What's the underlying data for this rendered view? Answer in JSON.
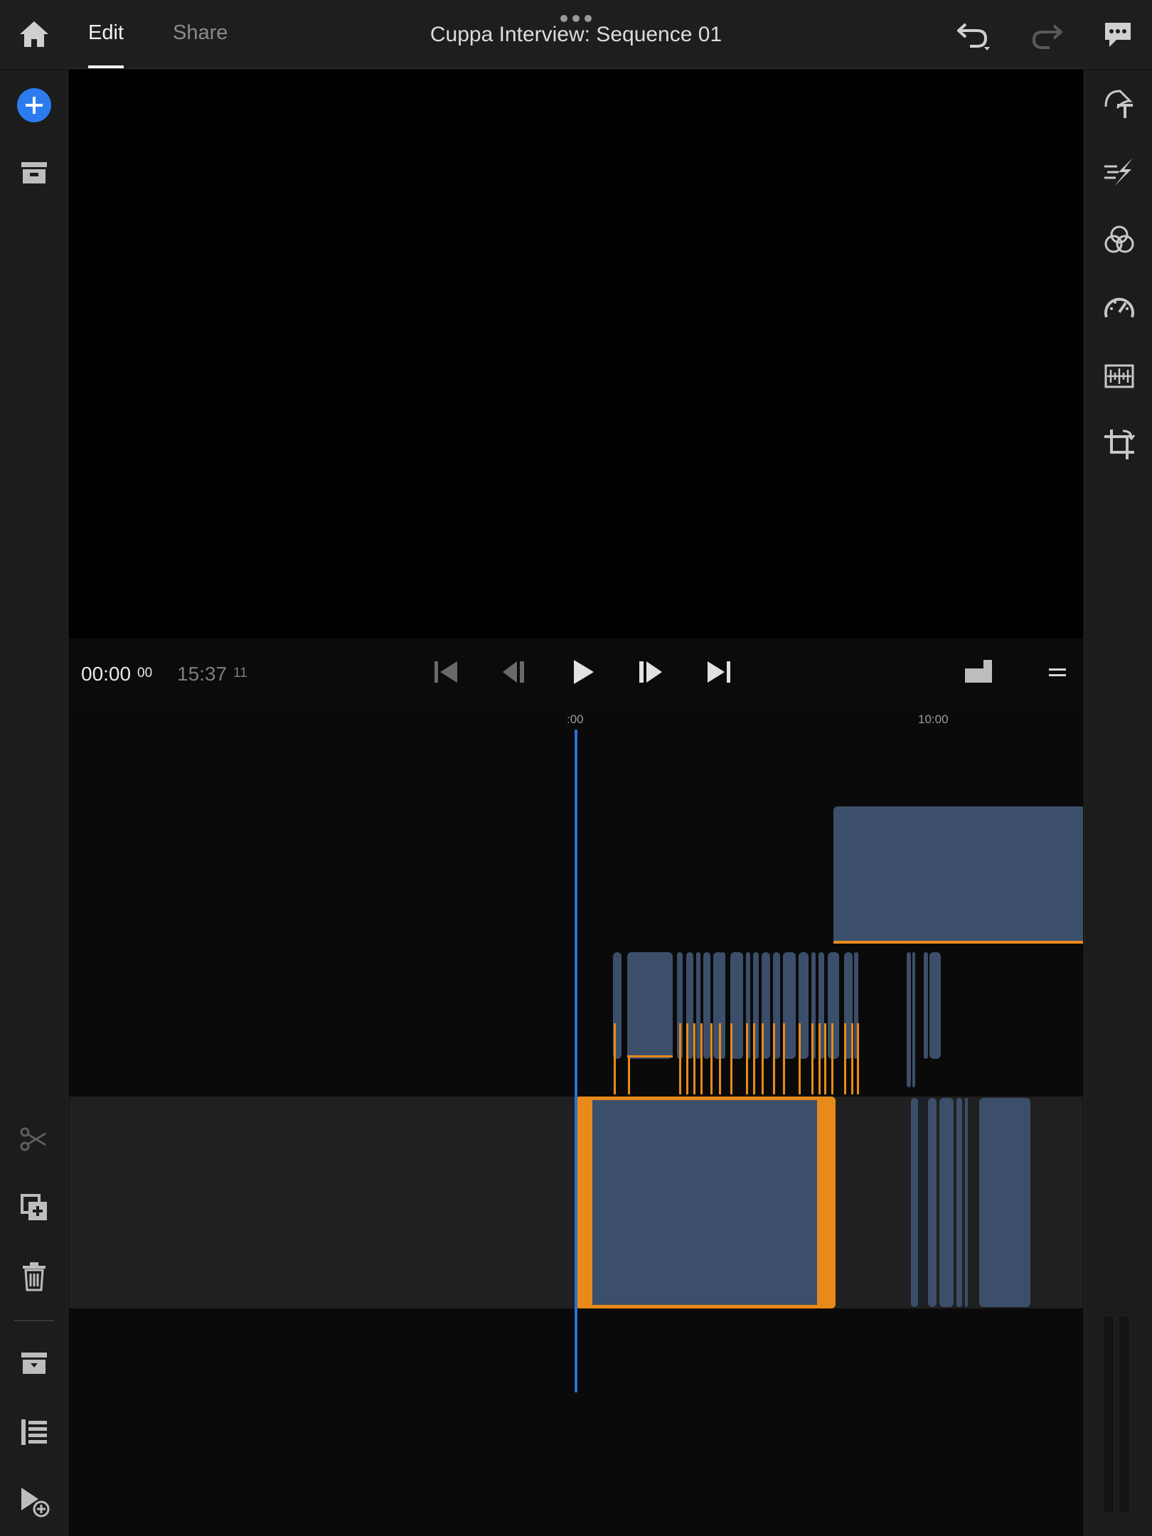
{
  "header": {
    "tabs": [
      {
        "label": "Edit",
        "active": true
      },
      {
        "label": "Share",
        "active": false
      }
    ],
    "title": "Cuppa Interview: Sequence 01",
    "icons": [
      "home-icon",
      "more-dots-icon",
      "undo-icon",
      "redo-icon",
      "feedback-icon"
    ]
  },
  "left_toolbar": {
    "top_items": [
      "add-media",
      "project-media"
    ],
    "bottom_items": [
      "split",
      "duplicate",
      "delete",
      "track-options",
      "clip-list",
      "add-to-timeline"
    ]
  },
  "right_toolbar": {
    "items": [
      "titles",
      "transitions",
      "color",
      "speed",
      "audio",
      "transform"
    ]
  },
  "transport": {
    "current_time": "00:00",
    "current_frames": "00",
    "duration": "15:37",
    "duration_frames": "11"
  },
  "timeline": {
    "ruler_labels": [
      ":00",
      "10:00"
    ],
    "playhead_time": "00:00"
  },
  "colors": {
    "accent_blue": "#2d6fd8",
    "selection_orange": "#e88a1a",
    "clip_blue": "#3b4f6a",
    "background": "#0a0a0a"
  }
}
